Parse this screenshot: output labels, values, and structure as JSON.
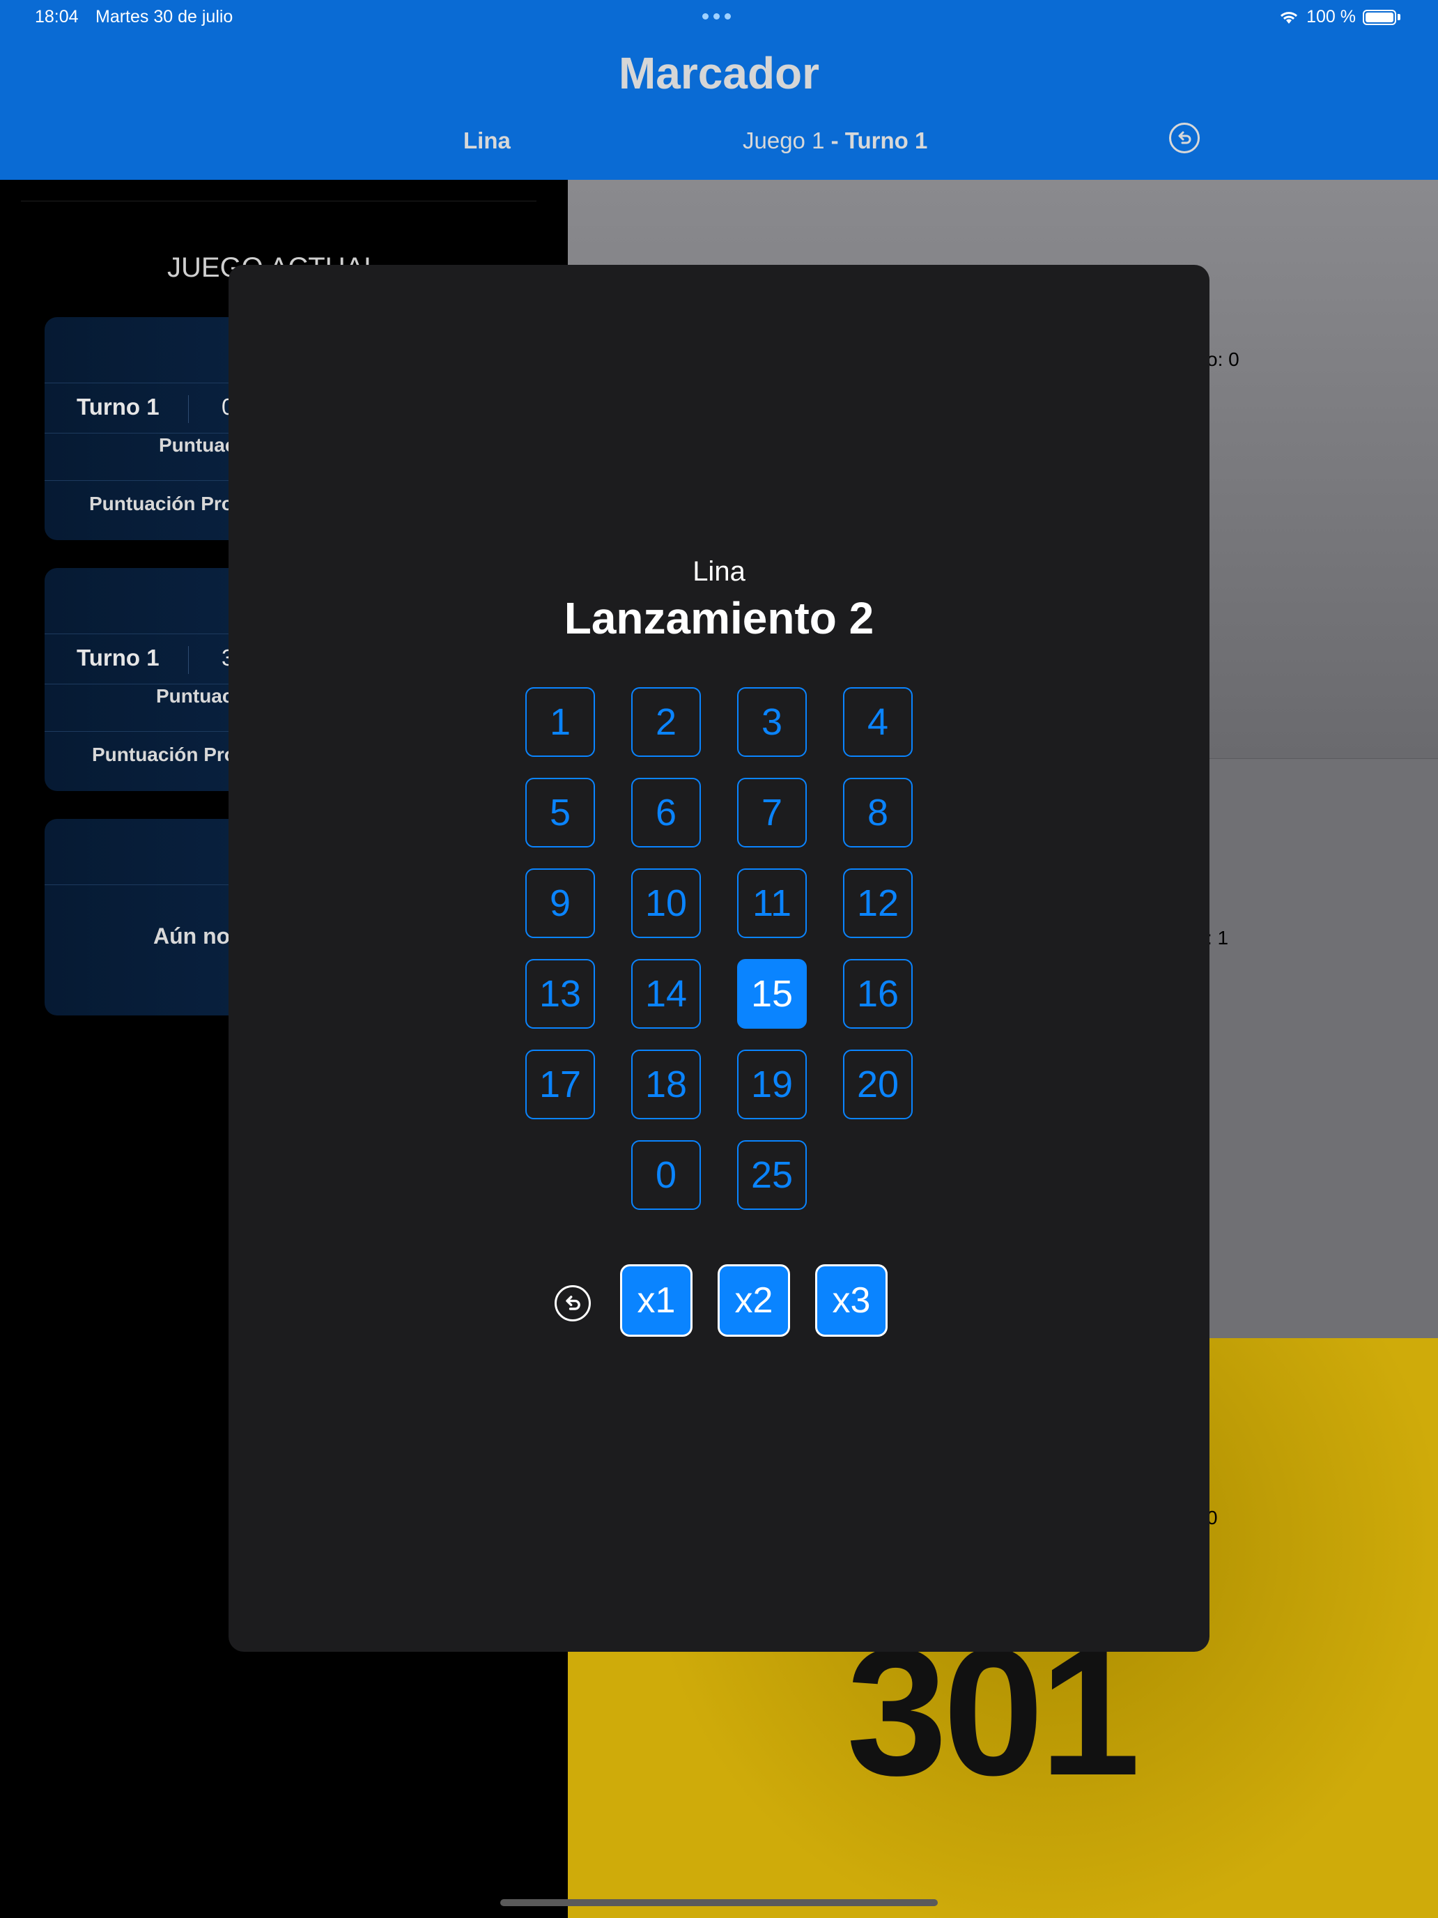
{
  "status": {
    "time": "18:04",
    "date": "Martes 30 de julio",
    "battery": "100 %"
  },
  "nav": {
    "title": "Marcador",
    "player": "Lina",
    "game": "Juego 1",
    "turn": "- Turno 1"
  },
  "left": {
    "section_title": "JUEGO ACTUAL",
    "cards": [
      {
        "turn": "Turno 1",
        "value": "0",
        "score_label": "Puntuac",
        "avg_label": "Puntuación Pro"
      },
      {
        "turn": "Turno 1",
        "value": "3",
        "score_label": "Puntuac",
        "avg_label": "Puntuación Pro"
      },
      {
        "empty_text": "Aún no"
      }
    ]
  },
  "right": {
    "text1": "o: 0",
    "text2": ": 1",
    "text3": "0",
    "big_score": "301"
  },
  "modal": {
    "player": "Lina",
    "title": "Lanzamiento 2",
    "keys": [
      "1",
      "2",
      "3",
      "4",
      "5",
      "6",
      "7",
      "8",
      "9",
      "10",
      "11",
      "12",
      "13",
      "14",
      "15",
      "16",
      "17",
      "18",
      "19",
      "20",
      "0",
      "25"
    ],
    "selected_key": "15",
    "multipliers": [
      "x1",
      "x2",
      "x3"
    ]
  },
  "colors": {
    "accent": "#0a84ff",
    "nav_bg": "#0a6bd4",
    "modal_bg": "#1c1c1e",
    "highlight": "#cfab0a"
  }
}
